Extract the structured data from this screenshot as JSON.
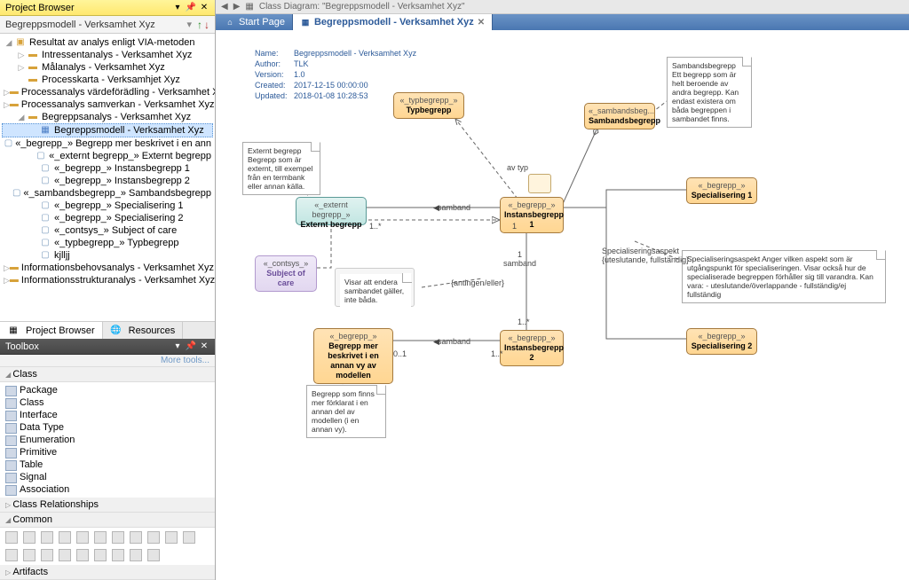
{
  "browser": {
    "panel_title": "Project Browser",
    "label": "Begreppsmodell - Verksamhet Xyz",
    "root": "Resultat av analys enligt VIA-metoden",
    "items": [
      {
        "label": "Intressentanalys - Verksamhet Xyz",
        "icon": "folder",
        "d": 1,
        "exp": "▷"
      },
      {
        "label": "Målanalys - Verksamhet Xyz",
        "icon": "folder",
        "d": 1,
        "exp": "▷"
      },
      {
        "label": "Processkarta - Verksamhjet Xyz",
        "icon": "folder",
        "d": 1,
        "exp": ""
      },
      {
        "label": "Processanalys värdeförädling - Verksamhet Xyz",
        "icon": "folder",
        "d": 1,
        "exp": "▷"
      },
      {
        "label": "Processanalys samverkan - Verksamhet Xyz",
        "icon": "folder",
        "d": 1,
        "exp": "▷"
      },
      {
        "label": "Begreppsanalys - Verksamhet Xyz",
        "icon": "folder",
        "d": 1,
        "exp": "◢"
      },
      {
        "label": "Begreppsmodell - Verksamhet Xyz",
        "icon": "diag",
        "d": 2,
        "sel": true
      },
      {
        "label": "«_begrepp_» Begrepp mer beskrivet i en ann",
        "icon": "elem",
        "d": 2
      },
      {
        "label": "«_externt begrepp_» Externt begrepp",
        "icon": "elem",
        "d": 2
      },
      {
        "label": "«_begrepp_» Instansbegrepp 1",
        "icon": "elem",
        "d": 2
      },
      {
        "label": "«_begrepp_» Instansbegrepp 2",
        "icon": "elem",
        "d": 2
      },
      {
        "label": "«_sambandsbegrepp_» Sambandsbegrepp",
        "icon": "elem",
        "d": 2
      },
      {
        "label": "«_begrepp_» Specialisering 1",
        "icon": "elem",
        "d": 2
      },
      {
        "label": "«_begrepp_» Specialisering 2",
        "icon": "elem",
        "d": 2
      },
      {
        "label": "«_contsys_» Subject of care",
        "icon": "elem",
        "d": 2
      },
      {
        "label": "«_typbegrepp_» Typbegrepp",
        "icon": "elem",
        "d": 2
      },
      {
        "label": "kjlljj",
        "icon": "elem",
        "d": 2
      },
      {
        "label": "Informationsbehovsanalys - Verksamhet Xyz",
        "icon": "folder",
        "d": 1,
        "exp": "▷"
      },
      {
        "label": "Informationsstrukturanalys - Verksamhet Xyz",
        "icon": "folder",
        "d": 1,
        "exp": "▷"
      }
    ],
    "tabs": [
      {
        "label": "Project Browser",
        "active": true
      },
      {
        "label": "Resources",
        "active": false
      }
    ]
  },
  "toolbox": {
    "title": "Toolbox",
    "more": "More tools...",
    "groups": [
      {
        "name": "Class",
        "open": true,
        "items": [
          "Package",
          "Class",
          "Interface",
          "Data Type",
          "Enumeration",
          "Primitive",
          "Table",
          "Signal",
          "Association"
        ]
      },
      {
        "name": "Class Relationships",
        "open": false
      },
      {
        "name": "Common",
        "open": true,
        "icons": 20
      },
      {
        "name": "Artifacts",
        "open": false
      }
    ]
  },
  "diagram": {
    "bread_crumb": "Class Diagram: \"Begreppsmodell - Verksamhet Xyz\"",
    "tabs": [
      {
        "label": "Start Page",
        "active": false,
        "closable": false
      },
      {
        "label": "Begreppsmodell - Verksamhet Xyz",
        "active": true,
        "closable": true
      }
    ],
    "meta": {
      "name_k": "Name:",
      "name_v": "Begreppsmodell - Verksamhet Xyz",
      "author_k": "Author:",
      "author_v": "TLK",
      "version_k": "Version:",
      "version_v": "1.0",
      "created_k": "Created:",
      "created_v": "2017-12-15 00:00:00",
      "updated_k": "Updated:",
      "updated_v": "2018-01-08 10:28:53"
    },
    "boxes": {
      "typ": {
        "stereo": "«_typbegrepp_»",
        "name": "Typbegrepp"
      },
      "samb": {
        "stereo": "«_sambandsbeg...",
        "name": "Sambandsbegrepp"
      },
      "ext": {
        "stereo": "«_externt begrepp_»",
        "name": "Externt begrepp"
      },
      "inst1": {
        "stereo": "«_begrepp_»",
        "name": "Instansbegrepp 1"
      },
      "spec1": {
        "stereo": "«_begrepp_»",
        "name": "Specialisering 1"
      },
      "soc": {
        "stereo": "«_contsys_»",
        "name": "Subject of care"
      },
      "mer": {
        "stereo": "«_begrepp_»",
        "name": "Begrepp mer beskrivet i en annan vy av modellen"
      },
      "inst2": {
        "stereo": "«_begrepp_»",
        "name": "Instansbegrepp 2"
      },
      "spec2": {
        "stereo": "«_begrepp_»",
        "name": "Specialisering 2"
      }
    },
    "notes": {
      "n1": "Externt begrepp\nBegrepp som är externt, till exempel från en termbank eller annan källa.",
      "n2": "Sambandsbegrepp\nEtt begrepp som är helt beroende av andra begrepp. Kan endast existera om båda begreppen i sambandet finns.",
      "n3": "Visar att endera sambandet gäller, inte båda.",
      "n4": "Specialiseringsaspekt\nAnger vilken aspekt som är utgångspunkt för specialiseringen.\nVisar också hur de specialiserade begreppen förhåller sig till varandra.\nKan vara:\n- uteslutande/överlappande\n- fullständig/ej fullständig",
      "n5": "Begrepp som finns mer förklarat i en annan del av modellen (i en annan vy)."
    },
    "labels": {
      "samband": "samband",
      "avtyp": "av typ",
      "antingen": "{antingen/eller}",
      "specasp": "Specialiseringsaspekt\n{uteslutande, fullständig}",
      "m1": "1..*",
      "m2": "1",
      "m3": "0..1"
    }
  }
}
